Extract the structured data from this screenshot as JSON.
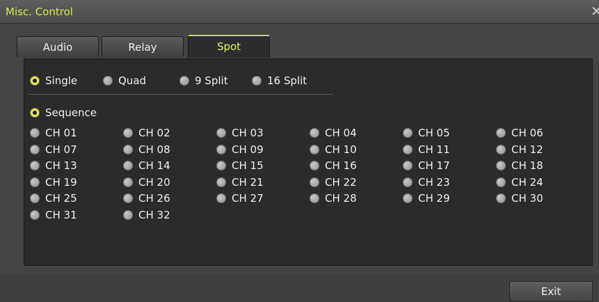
{
  "window": {
    "title": "Misc. Control",
    "close_icon": "close-icon"
  },
  "tabs": [
    {
      "label": "Audio",
      "active": false
    },
    {
      "label": "Relay",
      "active": false
    },
    {
      "label": "Spot",
      "active": true
    }
  ],
  "split_modes": [
    {
      "label": "Single",
      "selected": true
    },
    {
      "label": "Quad",
      "selected": false
    },
    {
      "label": "9 Split",
      "selected": false
    },
    {
      "label": "16 Split",
      "selected": false
    }
  ],
  "sequence": {
    "label": "Sequence",
    "selected": true
  },
  "channels": [
    "CH 01",
    "CH 02",
    "CH 03",
    "CH 04",
    "CH 05",
    "CH 06",
    "CH 07",
    "CH 08",
    "CH 09",
    "CH 10",
    "CH 11",
    "CH 12",
    "CH 13",
    "CH 14",
    "CH 15",
    "CH 16",
    "CH 17",
    "CH 18",
    "CH 19",
    "CH 20",
    "CH 21",
    "CH 22",
    "CH 23",
    "CH 24",
    "CH 25",
    "CH 26",
    "CH 27",
    "CH 28",
    "CH 29",
    "CH 30",
    "CH 31",
    "CH 32"
  ],
  "buttons": {
    "exit_label": "Exit"
  },
  "colors": {
    "accent": "#d7e84a",
    "panel": "#2b2b2b",
    "radio_on": "#e6eb4a"
  }
}
